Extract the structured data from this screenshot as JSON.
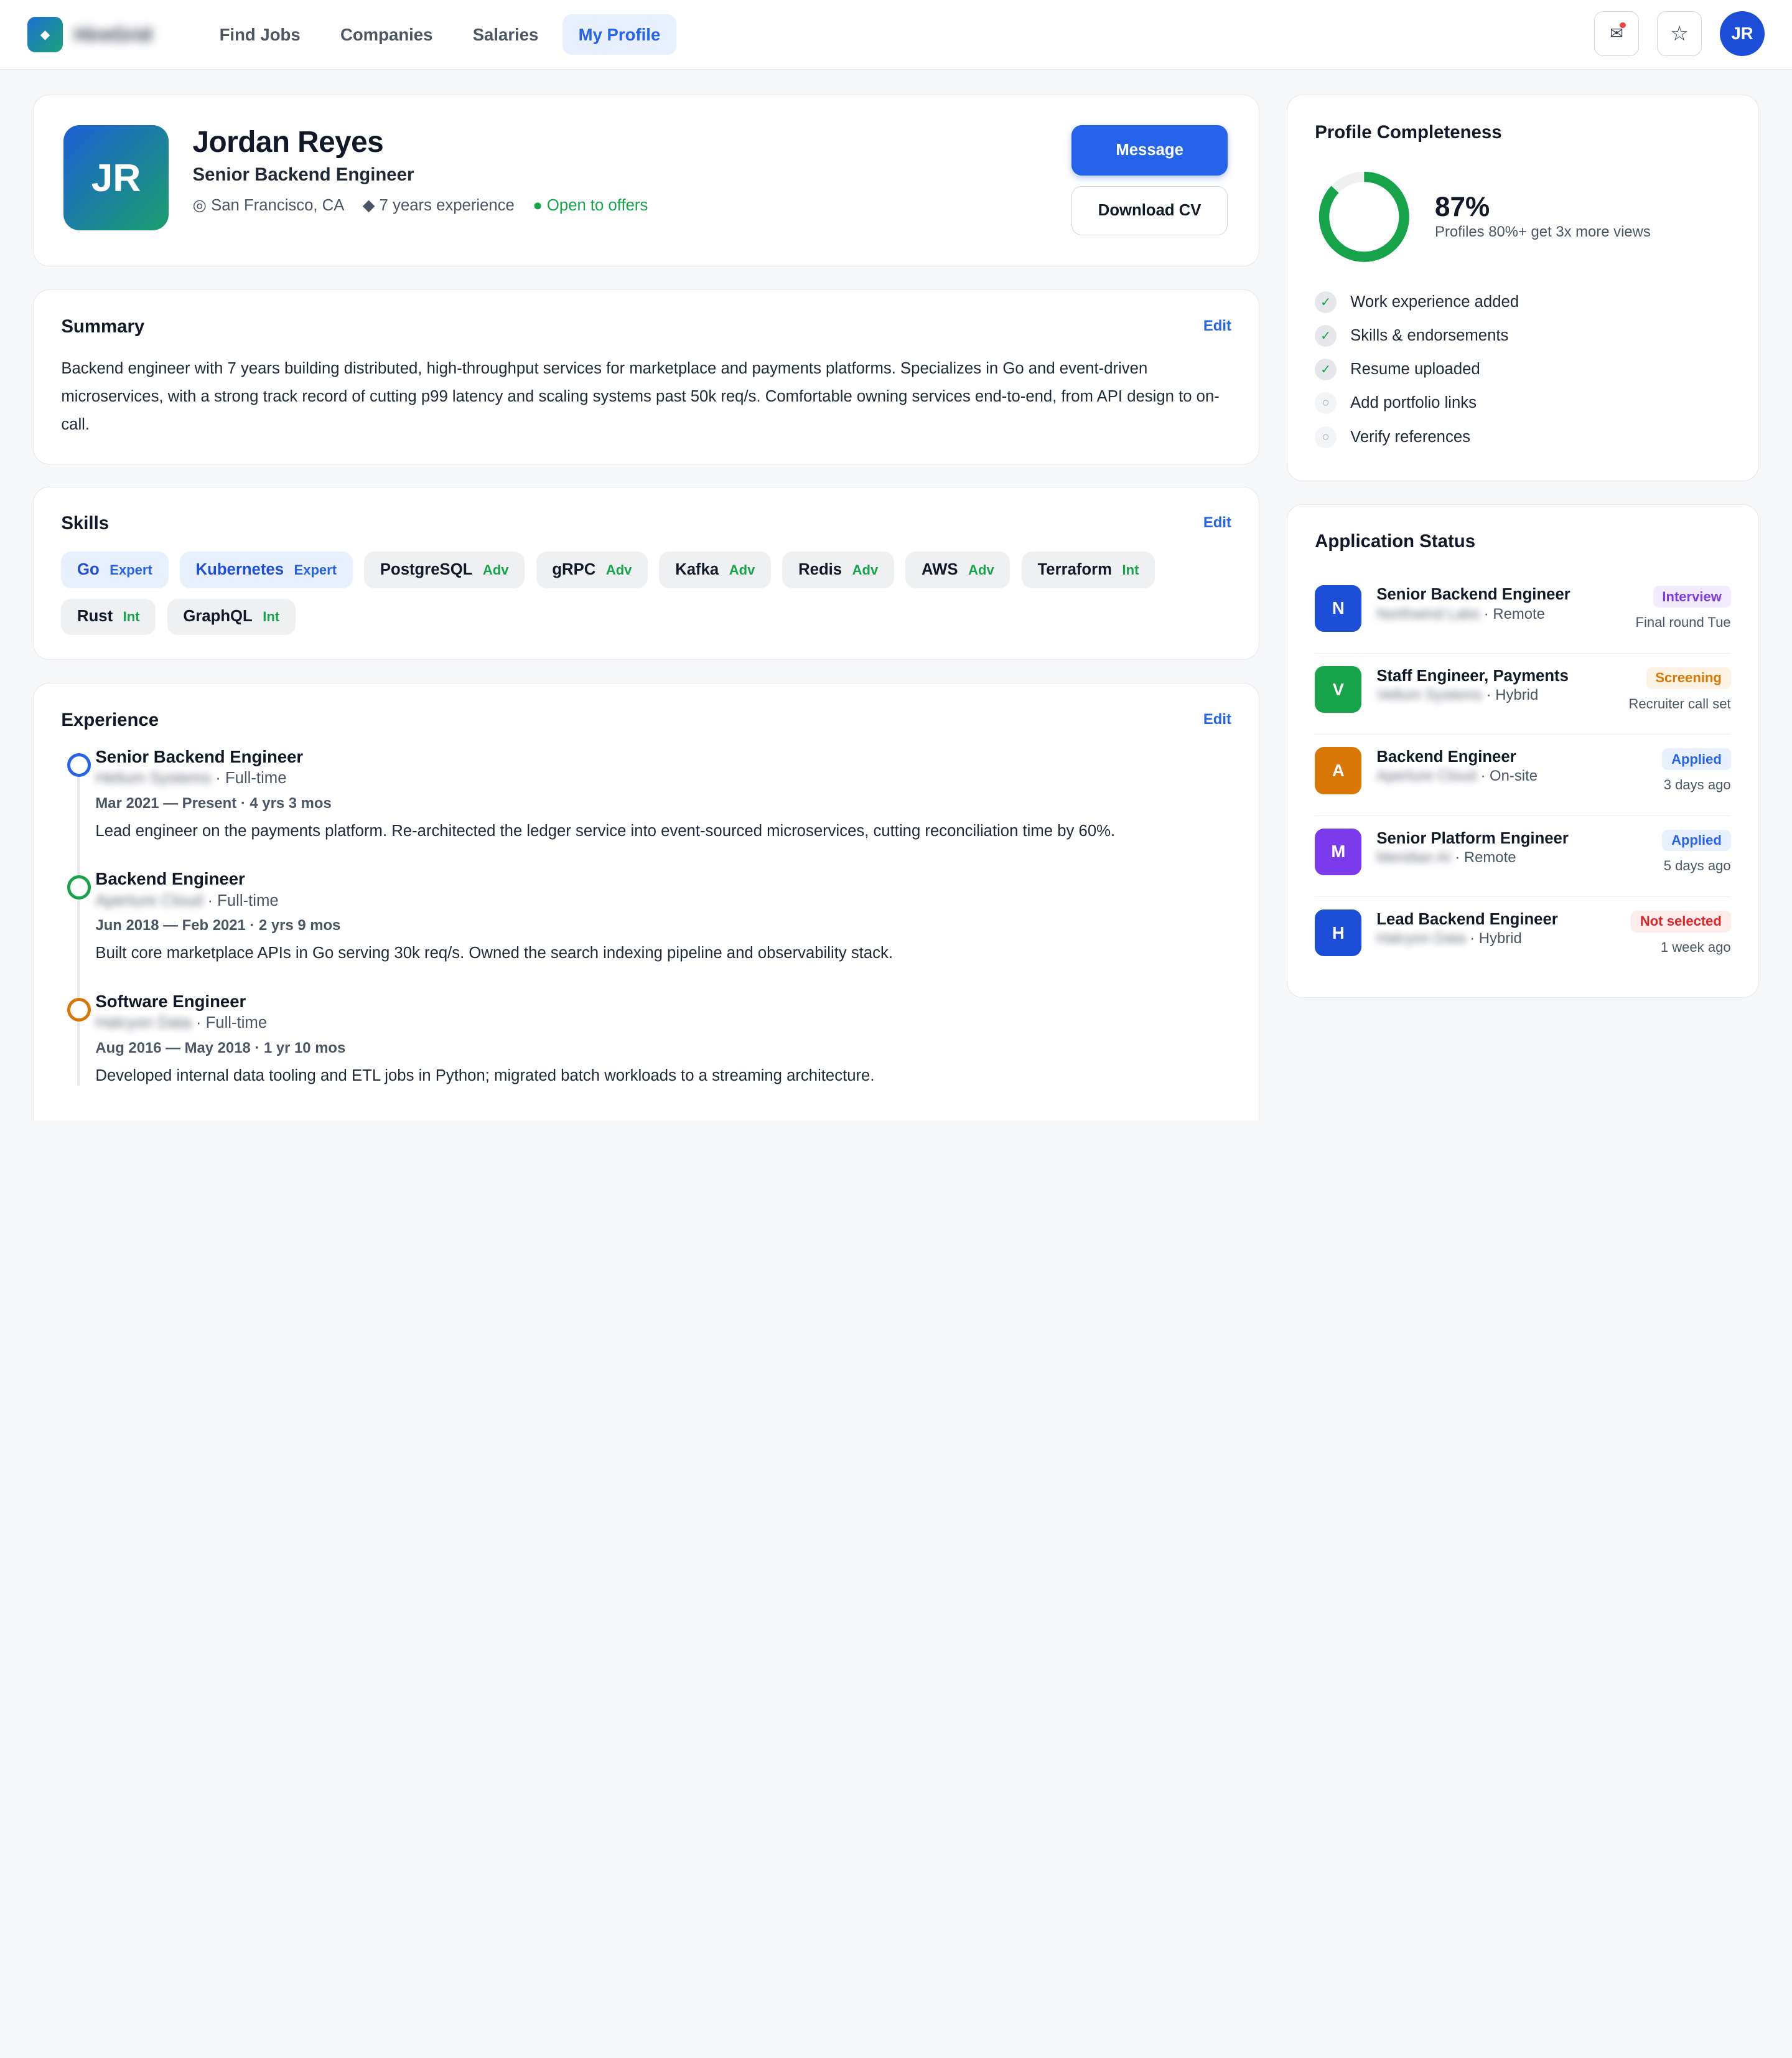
{
  "brand": {
    "name": "HireGrid"
  },
  "nav": [
    {
      "label": "Find Jobs",
      "active": false
    },
    {
      "label": "Companies",
      "active": false
    },
    {
      "label": "Salaries",
      "active": false
    },
    {
      "label": "My Profile",
      "active": true
    }
  ],
  "top": {
    "avatar": "JR"
  },
  "profile": {
    "initials": "JR",
    "name": "Jordan Reyes",
    "headline": "Senior Backend Engineer",
    "location": "◎ San Francisco, CA",
    "experience": "◆ 7 years experience",
    "availability": "● Open to offers",
    "message_label": "Message",
    "download_label": "Download CV"
  },
  "summary": {
    "title": "Summary",
    "edit": "Edit",
    "text": "Backend engineer with 7 years building distributed, high-throughput services for marketplace and payments platforms. Specializes in Go and event-driven microservices, with a strong track record of cutting p99 latency and scaling systems past 50k req/s. Comfortable owning services end-to-end, from API design to on-call."
  },
  "skills": {
    "title": "Skills",
    "edit": "Edit",
    "items": [
      {
        "name": "Go",
        "level": "Expert"
      },
      {
        "name": "Kubernetes",
        "level": "Expert"
      },
      {
        "name": "PostgreSQL",
        "level": "Adv"
      },
      {
        "name": "gRPC",
        "level": "Adv"
      },
      {
        "name": "Kafka",
        "level": "Adv"
      },
      {
        "name": "Redis",
        "level": "Adv"
      },
      {
        "name": "AWS",
        "level": "Adv"
      },
      {
        "name": "Terraform",
        "level": "Int"
      },
      {
        "name": "Rust",
        "level": "Int"
      },
      {
        "name": "GraphQL",
        "level": "Int"
      }
    ]
  },
  "experience": {
    "title": "Experience",
    "edit": "Edit",
    "items": [
      {
        "title": "Senior Backend Engineer",
        "company": "Helium Systems",
        "type": "· Full-time",
        "dates": "Mar 2021 — Present · 4 yrs 3 mos",
        "desc": "Lead engineer on the payments platform. Re-architected the ledger service into event-sourced microservices, cutting reconciliation time by 60%.",
        "color": "#2563eb"
      },
      {
        "title": "Backend Engineer",
        "company": "Aperture Cloud",
        "type": "· Full-time",
        "dates": "Jun 2018 — Feb 2021 · 2 yrs 9 mos",
        "desc": "Built core marketplace APIs in Go serving 30k req/s. Owned the search indexing pipeline and observability stack.",
        "color": "#16a34a"
      },
      {
        "title": "Software Engineer",
        "company": "Halcyon Data",
        "type": "· Full-time",
        "dates": "Aug 2016 — May 2018 · 1 yr 10 mos",
        "desc": "Developed internal data tooling and ETL jobs in Python; migrated batch workloads to a streaming architecture.",
        "color": "#d97706"
      }
    ]
  },
  "completeness": {
    "title": "Profile Completeness",
    "percent": 87,
    "percent_label": "87%",
    "sub": "Profiles 80%+ get 3x more views",
    "ring_color": "#16a34a",
    "items": [
      {
        "label": "Work experience added",
        "done": true
      },
      {
        "label": "Skills & endorsements",
        "done": true
      },
      {
        "label": "Resume uploaded",
        "done": true
      },
      {
        "label": "Add portfolio links",
        "done": false
      },
      {
        "label": "Verify references",
        "done": false
      }
    ]
  },
  "applications": {
    "title": "Application Status",
    "items": [
      {
        "logo": "N",
        "logo_color": "#1d4ed8",
        "title": "Senior Backend Engineer",
        "company": "Northwind Labs",
        "mode": "· Remote",
        "status": "Interview",
        "status_fg": "#7c3aed",
        "status_bg": "#f1ebfd",
        "note": "Final round Tue"
      },
      {
        "logo": "V",
        "logo_color": "#16a34a",
        "title": "Staff Engineer, Payments",
        "company": "Vellum Systems",
        "mode": "· Hybrid",
        "status": "Screening",
        "status_fg": "#d97706",
        "status_bg": "#fdf3e4",
        "note": "Recruiter call set"
      },
      {
        "logo": "A",
        "logo_color": "#d97706",
        "title": "Backend Engineer",
        "company": "Aperture Cloud",
        "mode": "· On-site",
        "status": "Applied",
        "status_fg": "#2563eb",
        "status_bg": "#e8effd",
        "note": "3 days ago"
      },
      {
        "logo": "M",
        "logo_color": "#7c3aed",
        "title": "Senior Platform Engineer",
        "company": "Meridian AI",
        "mode": "· Remote",
        "status": "Applied",
        "status_fg": "#2563eb",
        "status_bg": "#e8effd",
        "note": "5 days ago"
      },
      {
        "logo": "H",
        "logo_color": "#1d4ed8",
        "title": "Lead Backend Engineer",
        "company": "Halcyon Data",
        "mode": "· Hybrid",
        "status": "Not selected",
        "status_fg": "#dc2626",
        "status_bg": "#fdecec",
        "note": "1 week ago"
      }
    ]
  }
}
